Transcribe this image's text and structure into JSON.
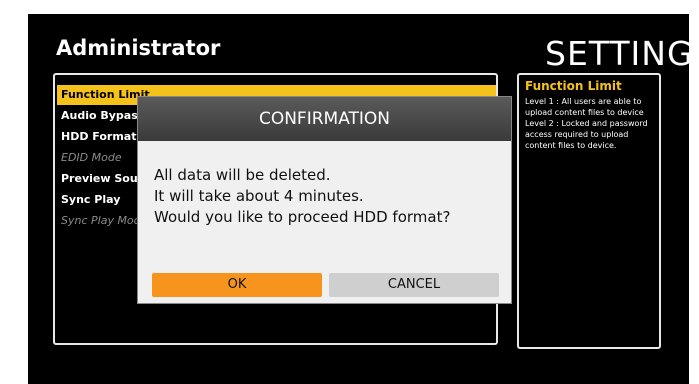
{
  "header": {
    "title": "Administrator",
    "settings_label": "SETTINGS"
  },
  "menu": {
    "items": [
      {
        "label": "Function Limit",
        "state": "selected"
      },
      {
        "label": "Audio Bypass",
        "state": "enabled"
      },
      {
        "label": "HDD Format",
        "state": "enabled"
      },
      {
        "label": "EDID Mode",
        "state": "disabled"
      },
      {
        "label": "Preview Source",
        "state": "enabled"
      },
      {
        "label": "Sync Play",
        "state": "enabled"
      },
      {
        "label": "Sync Play Mode",
        "state": "disabled"
      }
    ]
  },
  "help": {
    "title": "Function Limit",
    "text": "Level 1 : All users are able to upload content files to device\nLevel 2 : Locked and password access required to upload content files to device."
  },
  "dialog": {
    "title": "CONFIRMATION",
    "line1": "All data will be deleted.",
    "line2": "It will take about 4 minutes.",
    "line3": "Would you like to proceed HDD format?",
    "ok_label": "OK",
    "cancel_label": "CANCEL"
  },
  "colors": {
    "selected_bg": "#f5c21c",
    "help_title": "#f5c21c",
    "ok_button": "#f7941d",
    "cancel_button": "#cfcfcf"
  }
}
